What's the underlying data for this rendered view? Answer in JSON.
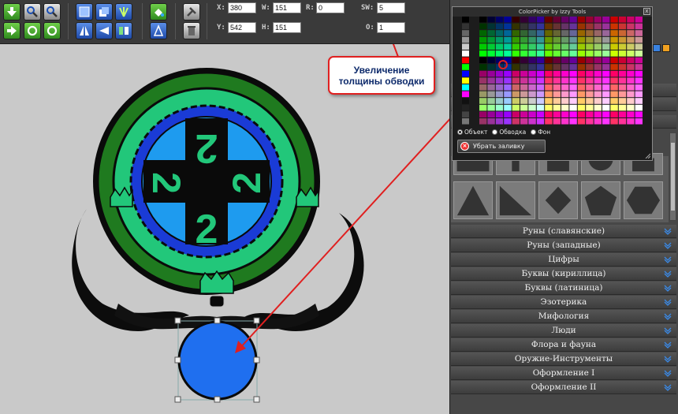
{
  "fields": {
    "x": {
      "label": "X:",
      "value": "380"
    },
    "w": {
      "label": "W:",
      "value": "151"
    },
    "r": {
      "label": "R:",
      "value": "0"
    },
    "sw": {
      "label": "SW:",
      "value": "5"
    },
    "y": {
      "label": "Y:",
      "value": "542"
    },
    "h": {
      "label": "H:",
      "value": "151"
    },
    "o": {
      "label": "O:",
      "value": "1"
    }
  },
  "callout": {
    "text": "Увеличение толщины обводки"
  },
  "color_picker": {
    "title": "ColorPicker by Izzy Tools",
    "close_label": "x",
    "options": [
      "Объект",
      "Обводка",
      "Фон"
    ],
    "selected_option": "Объект",
    "remove_fill_label": "Убрать заливку"
  },
  "categories": [
    "Руны (славянские)",
    "Руны (западные)",
    "Цифры",
    "Буквы (кириллица)",
    "Буквы (латиница)",
    "Эзотерика",
    "Мифология",
    "Люди",
    "Флора и фауна",
    "Оружие-Инструменты",
    "Оформление I",
    "Оформление II"
  ],
  "emblem": {
    "digits": [
      "2",
      "2",
      "2",
      "2"
    ]
  },
  "colors": {
    "emblem_green": "#22c77a",
    "emblem_dark_green": "#1f7a1f",
    "emblem_blue": "#1a3bd6",
    "emblem_sky": "#1e9bef",
    "circle_fill": "#1f6fef",
    "callout_border": "#e02020"
  }
}
